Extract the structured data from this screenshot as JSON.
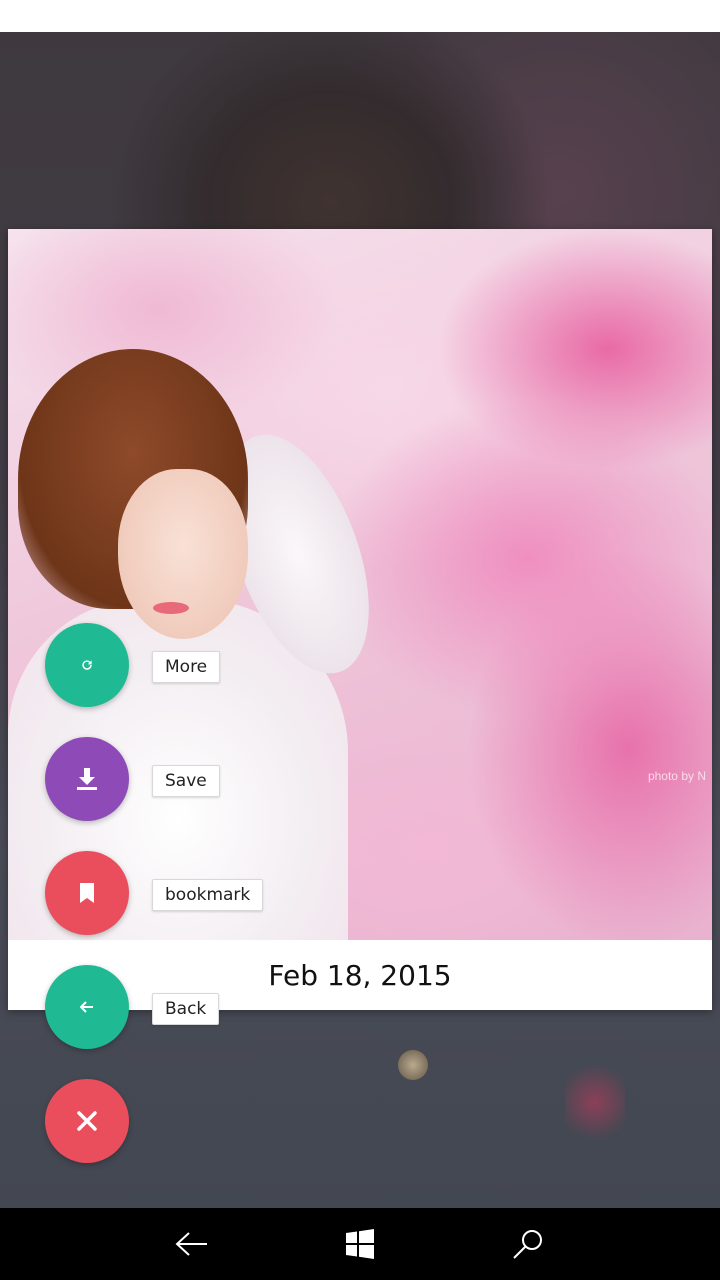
{
  "card": {
    "date": "Feb 18, 2015",
    "watermark": "photo by N"
  },
  "menu": {
    "items": [
      {
        "label": "More",
        "icon": "refresh-icon",
        "color": "#1fb993"
      },
      {
        "label": "Save",
        "icon": "download-icon",
        "color": "#8e4bb8"
      },
      {
        "label": "bookmark",
        "icon": "bookmark-icon",
        "color": "#ea4e5d"
      },
      {
        "label": "Back",
        "icon": "arrow-left-icon",
        "color": "#1fb993"
      }
    ],
    "close": {
      "icon": "close-icon",
      "color": "#ea4e5d"
    }
  },
  "nav": {
    "back": "back-arrow-icon",
    "home": "windows-icon",
    "search": "search-icon"
  }
}
